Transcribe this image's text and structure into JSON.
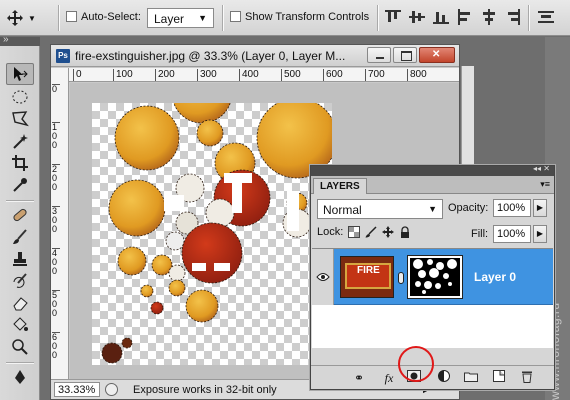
{
  "options_bar": {
    "auto_select_label": "Auto-Select:",
    "layer_dropdown": "Layer",
    "show_transform_label": "Show Transform Controls",
    "auto_select_checked": false,
    "show_transform_checked": false
  },
  "document": {
    "title": "fire-exstinguisher.jpg @ 33.3% (Layer 0, Layer M...",
    "ps_icon": "Ps",
    "ruler_h": [
      "0",
      "100",
      "200",
      "300",
      "400",
      "500",
      "600",
      "700",
      "800"
    ],
    "ruler_v": [
      "0",
      "100",
      "200",
      "300",
      "400",
      "500",
      "600",
      "700"
    ],
    "zoom": "33.33%",
    "status": "Exposure works in 32-bit only"
  },
  "layers_panel": {
    "tab": "LAYERS",
    "blend_mode": "Normal",
    "opacity_label": "Opacity:",
    "opacity_value": "100%",
    "lock_label": "Lock:",
    "fill_label": "Fill:",
    "fill_value": "100%",
    "layer_name": "Layer 0",
    "thumb_text": "FIRE",
    "bottom_icons": [
      "link-icon",
      "fx-icon",
      "add-mask-icon",
      "adjustment-icon",
      "group-icon",
      "new-layer-icon",
      "trash-icon"
    ]
  },
  "watermark": "www.hronofag.ru",
  "colors": {
    "selection": "#3f93e1",
    "highlight_circle": "#e01818"
  }
}
